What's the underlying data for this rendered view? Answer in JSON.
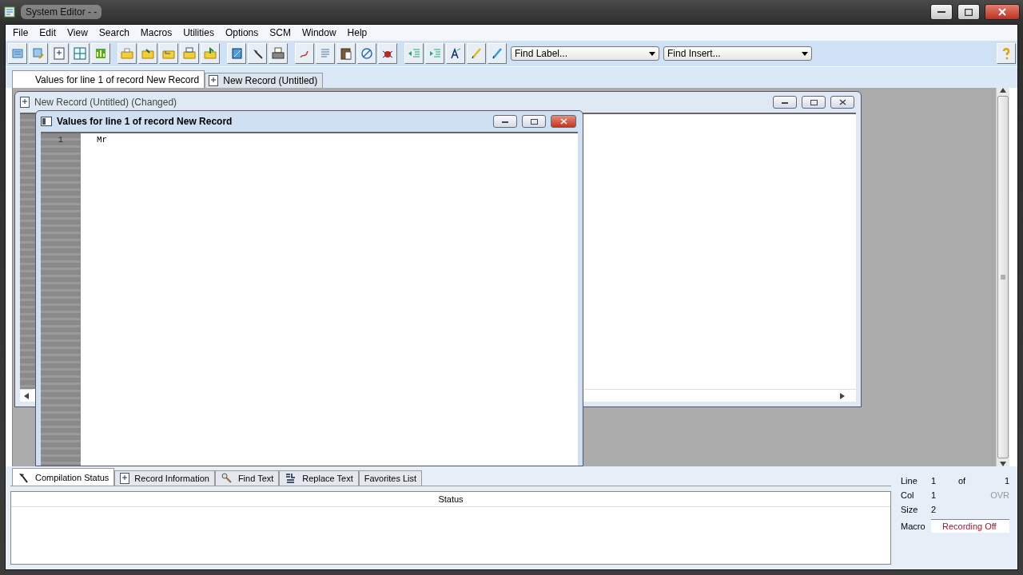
{
  "window": {
    "title": "System Editor - -"
  },
  "menu": [
    "File",
    "Edit",
    "View",
    "Search",
    "Macros",
    "Utilities",
    "Options",
    "SCM",
    "Window",
    "Help"
  ],
  "toolbar": {
    "dropdowns": [
      {
        "value": "Find Label..."
      },
      {
        "value": "Find Insert..."
      }
    ]
  },
  "document_tabs": [
    {
      "label": "Values for line 1 of record New Record",
      "selected": true
    },
    {
      "label": "New Record (Untitled)",
      "selected": false
    }
  ],
  "windows": [
    {
      "title": "New Record (Untitled) (Changed)",
      "active": false
    },
    {
      "title": "Values for line 1 of record New Record",
      "active": true,
      "lines": [
        {
          "number": "1",
          "text": "Mr"
        }
      ]
    }
  ],
  "bottom_tabs": [
    {
      "label": "Compilation Status",
      "selected": true
    },
    {
      "label": "Record Information",
      "selected": false
    },
    {
      "label": "Find Text",
      "selected": false
    },
    {
      "label": "Replace Text",
      "selected": false
    },
    {
      "label": "Favorites List",
      "selected": false
    }
  ],
  "status_table": {
    "columns": [
      "Status"
    ]
  },
  "info": {
    "rows": [
      {
        "label": "Line",
        "value": "1"
      },
      {
        "label": "Col",
        "value": "1"
      },
      {
        "label": "Size",
        "value": "2"
      }
    ],
    "of_label": "of",
    "of_value": "1",
    "mode": "OVR",
    "mode_on": false,
    "macro_label": "Macro",
    "macro_value": "Recording Off"
  }
}
